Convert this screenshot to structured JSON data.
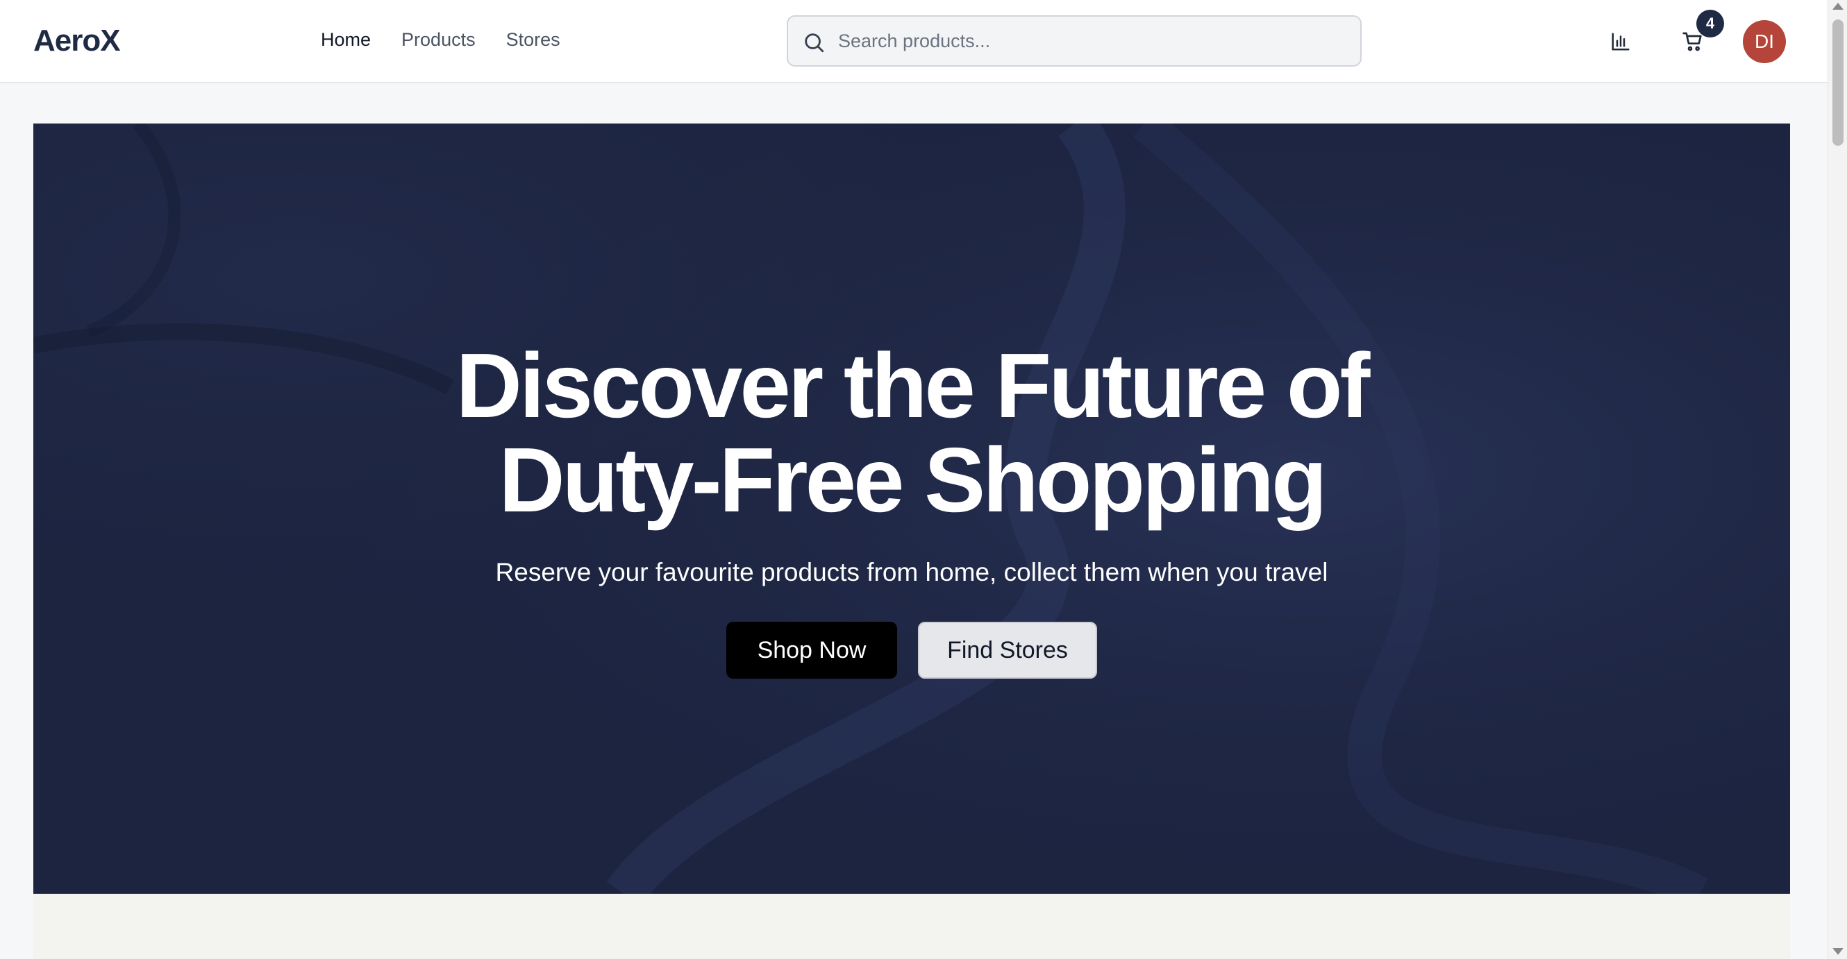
{
  "header": {
    "logo": "AeroX",
    "nav": [
      {
        "label": "Home",
        "active": true
      },
      {
        "label": "Products",
        "active": false
      },
      {
        "label": "Stores",
        "active": false
      }
    ],
    "search": {
      "placeholder": "Search products...",
      "value": ""
    },
    "icons": {
      "analytics": "bar-chart-icon",
      "cart": "shopping-cart-icon"
    },
    "cart_count": "4",
    "avatar_initials": "DI"
  },
  "hero": {
    "title_line1": "Discover the Future of",
    "title_line2": "Duty-Free Shopping",
    "subtitle": "Reserve your favourite products from home, collect them when you travel",
    "primary_button": "Shop Now",
    "secondary_button": "Find Stores"
  },
  "colors": {
    "brand": "#1f2a44",
    "hero_bg": "#1c2440",
    "avatar": "#b5453a",
    "primary_button": "#000000",
    "secondary_button": "#e5e7eb"
  }
}
